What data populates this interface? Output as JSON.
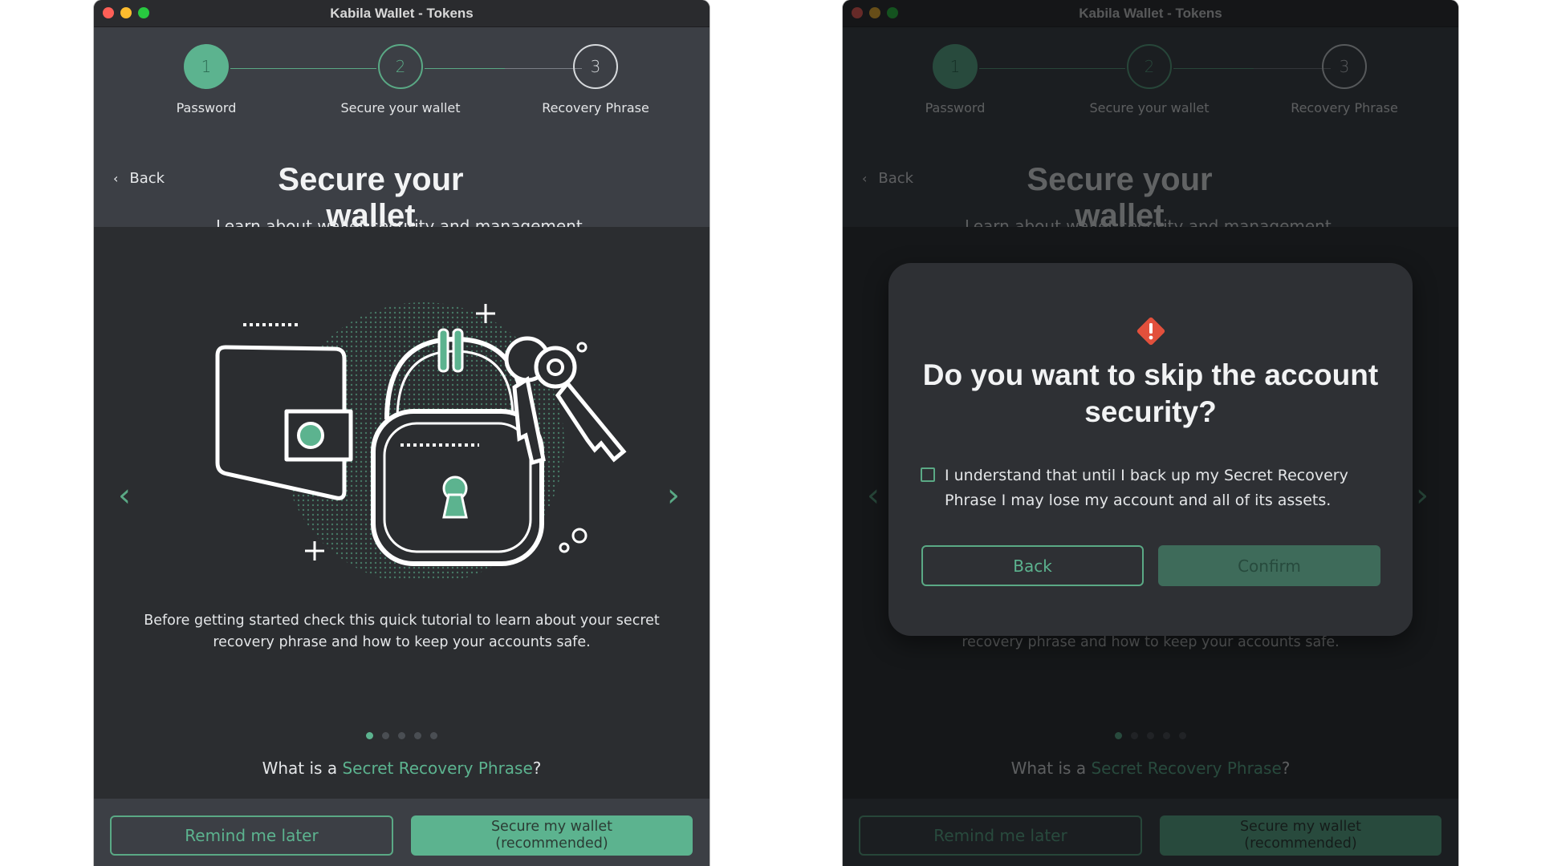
{
  "window_title": "Kabila Wallet - Tokens",
  "steps": [
    {
      "number": "1",
      "label": "Password"
    },
    {
      "number": "2",
      "label": "Secure your wallet"
    },
    {
      "number": "3",
      "label": "Recovery Phrase"
    }
  ],
  "back_label": "Back",
  "page_title": "Secure your wallet",
  "subtitle": "Learn about wallet security and management.",
  "tutorial": {
    "description": "Before getting started check this quick tutorial to learn about your secret recovery phrase and how to keep your accounts safe.",
    "slide_count": 5,
    "active_slide": 1,
    "question_prefix": "What is a ",
    "question_link": "Secret Recovery Phrase",
    "question_suffix": "?"
  },
  "footer": {
    "remind_label": "Remind me later",
    "secure_label_line1": "Secure my wallet",
    "secure_label_line2": "(recommended)"
  },
  "modal": {
    "title": "Do you want to skip the account security?",
    "consent_text": "I understand that until I back up my Secret Recovery Phrase I may lose my account and all of its assets.",
    "back_label": "Back",
    "confirm_label": "Confirm",
    "checkbox_checked": false
  },
  "colors": {
    "accent": "#5cb38f",
    "warning": "#e2503c"
  },
  "icons": {
    "prev": "chevron-left-icon",
    "next": "chevron-right-icon",
    "back": "chevron-left-icon",
    "warning": "warning-diamond-icon"
  }
}
